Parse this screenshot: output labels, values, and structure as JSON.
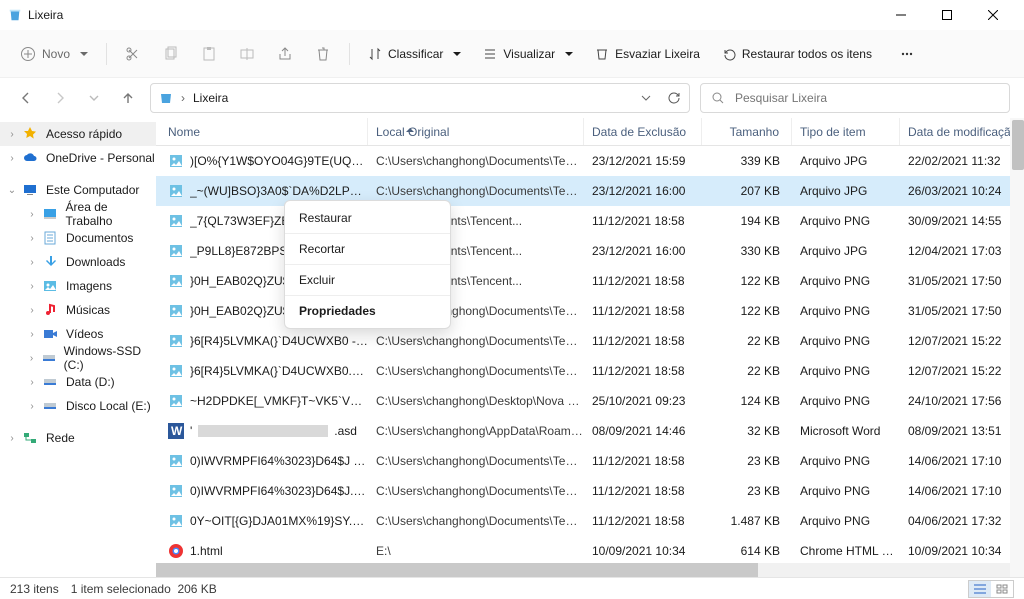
{
  "window": {
    "title": "Lixeira"
  },
  "toolbar": {
    "new": "Novo",
    "sort": "Classificar",
    "view": "Visualizar",
    "empty": "Esvaziar Lixeira",
    "restore_all": "Restaurar todos os itens"
  },
  "address": {
    "location": "Lixeira"
  },
  "search": {
    "placeholder": "Pesquisar Lixeira"
  },
  "sidebar": {
    "items": [
      {
        "label": "Acesso rápido",
        "icon": "star",
        "twisty": "›"
      },
      {
        "label": "OneDrive - Personal",
        "icon": "cloud",
        "twisty": "›"
      },
      {
        "label": "Este Computador",
        "icon": "pc",
        "twisty": "⌄"
      },
      {
        "label": "Área de Trabalho",
        "icon": "desktop",
        "twisty": "›",
        "indent": 1
      },
      {
        "label": "Documentos",
        "icon": "docs",
        "twisty": "›",
        "indent": 1
      },
      {
        "label": "Downloads",
        "icon": "down",
        "twisty": "›",
        "indent": 1
      },
      {
        "label": "Imagens",
        "icon": "pics",
        "twisty": "›",
        "indent": 1
      },
      {
        "label": "Músicas",
        "icon": "music",
        "twisty": "›",
        "indent": 1
      },
      {
        "label": "Vídeos",
        "icon": "video",
        "twisty": "›",
        "indent": 1
      },
      {
        "label": "Windows-SSD (C:)",
        "icon": "disk",
        "twisty": "›",
        "indent": 1
      },
      {
        "label": "Data (D:)",
        "icon": "disk",
        "twisty": "›",
        "indent": 1
      },
      {
        "label": "Disco Local (E:)",
        "icon": "disk",
        "twisty": "›",
        "indent": 1
      },
      {
        "label": "Rede",
        "icon": "net",
        "twisty": "›"
      }
    ]
  },
  "columns": {
    "name": "Nome",
    "orig": "Local Original",
    "del": "Data de Exclusão",
    "size": "Tamanho",
    "type": "Tipo de item",
    "mod": "Data de modificaçã"
  },
  "rows": [
    {
      "name": ")[O%{Y1W$OYO04G}9TE(UQP.jpg",
      "orig": "C:\\Users\\changhong\\Documents\\Tencent...",
      "del": "23/12/2021 15:59",
      "size": "339 KB",
      "type": "Arquivo JPG",
      "mod": "22/02/2021 11:32",
      "ficon": "img"
    },
    {
      "name": "_~(WU]BSO}3A0$`DA%D2LPR.jpg",
      "orig": "C:\\Users\\changhong\\Documents\\Tencent...",
      "del": "23/12/2021 16:00",
      "size": "207 KB",
      "type": "Arquivo JPG",
      "mod": "26/03/2021 10:24",
      "ficon": "img",
      "selected": true
    },
    {
      "name": "_7{QL73W3EF}ZEYG%R",
      "orig": "hong\\Documents\\Tencent...",
      "del": "11/12/2021 18:58",
      "size": "194 KB",
      "type": "Arquivo PNG",
      "mod": "30/09/2021 14:55",
      "ficon": "img"
    },
    {
      "name": "_P9LL8}E872BPSG{23K",
      "orig": "hong\\Documents\\Tencent...",
      "del": "23/12/2021 16:00",
      "size": "330 KB",
      "type": "Arquivo JPG",
      "mod": "12/04/2021 17:03",
      "ficon": "img"
    },
    {
      "name": "}0H_EAB02Q}ZU$OR2@",
      "orig": "hong\\Documents\\Tencent...",
      "del": "11/12/2021 18:58",
      "size": "122 KB",
      "type": "Arquivo PNG",
      "mod": "31/05/2021 17:50",
      "ficon": "img"
    },
    {
      "name": "}0H_EAB02Q}ZU$OR2@35ZC1.png",
      "orig": "C:\\Users\\changhong\\Documents\\Tencent...",
      "del": "11/12/2021 18:58",
      "size": "122 KB",
      "type": "Arquivo PNG",
      "mod": "31/05/2021 17:50",
      "ficon": "img"
    },
    {
      "name": "}6[R4}5LVMKA(}`D4UCWXB0 - Copi...",
      "orig": "C:\\Users\\changhong\\Documents\\Tencent...",
      "del": "11/12/2021 18:58",
      "size": "22 KB",
      "type": "Arquivo PNG",
      "mod": "12/07/2021 15:22",
      "ficon": "img"
    },
    {
      "name": "}6[R4}5LVMKA(}`D4UCWXB0.png",
      "orig": "C:\\Users\\changhong\\Documents\\Tencent...",
      "del": "11/12/2021 18:58",
      "size": "22 KB",
      "type": "Arquivo PNG",
      "mod": "12/07/2021 15:22",
      "ficon": "img"
    },
    {
      "name": "~H2DPDKE[_VMKF}T~VK5`VT.png",
      "orig": "C:\\Users\\changhong\\Desktop\\Nova pasta",
      "del": "25/10/2021 09:23",
      "size": "124 KB",
      "type": "Arquivo PNG",
      "mod": "24/10/2021 17:56",
      "ficon": "img"
    },
    {
      "name": "REDACTED.asd",
      "orig": "C:\\Users\\changhong\\AppData\\Roaming\\...",
      "del": "08/09/2021 14:46",
      "size": "32 KB",
      "type": "Microsoft Word",
      "mod": "08/09/2021 13:51",
      "ficon": "word",
      "redact": true
    },
    {
      "name": "0)IWVRMPFI64%3023}D64$J - Copi...",
      "orig": "C:\\Users\\changhong\\Documents\\Tencent...",
      "del": "11/12/2021 18:58",
      "size": "23 KB",
      "type": "Arquivo PNG",
      "mod": "14/06/2021 17:10",
      "ficon": "img"
    },
    {
      "name": "0)IWVRMPFI64%3023}D64$J.png",
      "orig": "C:\\Users\\changhong\\Documents\\Tencent...",
      "del": "11/12/2021 18:58",
      "size": "23 KB",
      "type": "Arquivo PNG",
      "mod": "14/06/2021 17:10",
      "ficon": "img"
    },
    {
      "name": "0Y~OIT[{G}DJA01MX%19}SY.png",
      "orig": "C:\\Users\\changhong\\Documents\\Tencent...",
      "del": "11/12/2021 18:58",
      "size": "1.487 KB",
      "type": "Arquivo PNG",
      "mod": "04/06/2021 17:32",
      "ficon": "img"
    },
    {
      "name": "1.html",
      "orig": "E:\\",
      "del": "10/09/2021 10:34",
      "size": "614 KB",
      "type": "Chrome HTML Do...",
      "mod": "10/09/2021 10:34",
      "ficon": "chrome"
    }
  ],
  "context_menu": {
    "restore": "Restaurar",
    "cut": "Recortar",
    "delete": "Excluir",
    "properties": "Propriedades"
  },
  "status": {
    "count": "213 itens",
    "selection": "1 item selecionado",
    "sel_size": "206 KB"
  }
}
